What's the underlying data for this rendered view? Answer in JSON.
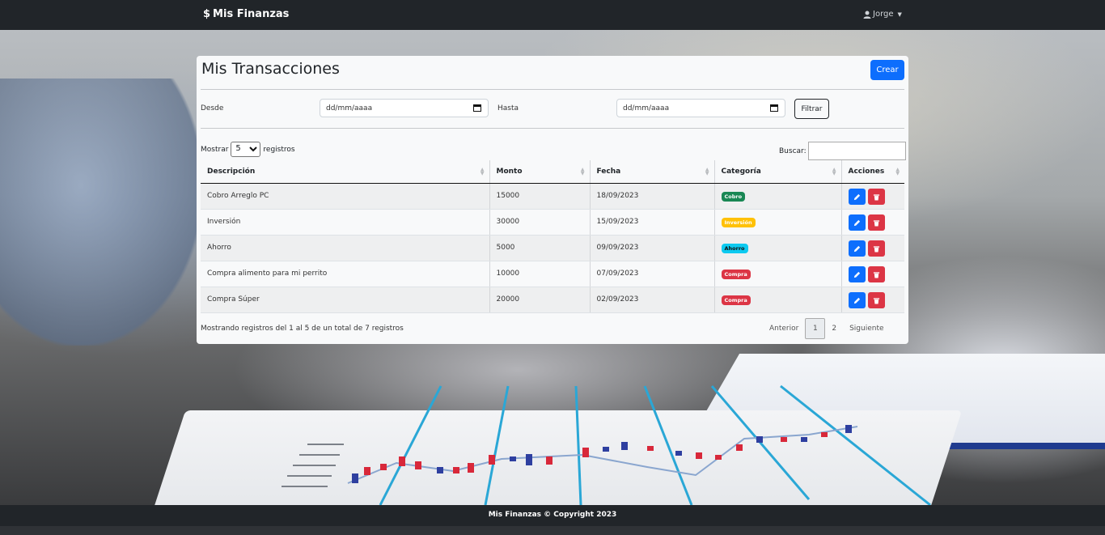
{
  "navbar": {
    "brand": "Mis Finanzas",
    "brand_icon": "dollar-sign-icon",
    "user": "Jorge",
    "user_icon": "person-icon"
  },
  "card": {
    "title": "Mis Transacciones",
    "create_label": "Crear"
  },
  "filter": {
    "from_label": "Desde",
    "from_placeholder": "dd/mm/aaaa",
    "to_label": "Hasta",
    "to_placeholder": "dd/mm/aaaa",
    "button": "Filtrar"
  },
  "table_controls": {
    "show_label": "Mostrar",
    "show_value": "5",
    "records_label": "registros",
    "search_label": "Buscar:"
  },
  "table": {
    "headers": [
      "Descripción",
      "Monto",
      "Fecha",
      "Categoría",
      "Acciones"
    ],
    "rows": [
      {
        "descripcion": "Cobro Arreglo PC",
        "monto": "15000",
        "fecha": "18/09/2023",
        "categoria": "Cobro",
        "color": "#198754"
      },
      {
        "descripcion": "Inversión",
        "monto": "30000",
        "fecha": "15/09/2023",
        "categoria": "Inversión",
        "color": "#ffc107"
      },
      {
        "descripcion": "Ahorro",
        "monto": "5000",
        "fecha": "09/09/2023",
        "categoria": "Ahorro",
        "color": "#0dcaf0"
      },
      {
        "descripcion": "Compra alimento para mi perrito",
        "monto": "10000",
        "fecha": "07/09/2023",
        "categoria": "Compra",
        "color": "#dc3545"
      },
      {
        "descripcion": "Compra Súper",
        "monto": "20000",
        "fecha": "02/09/2023",
        "categoria": "Compra",
        "color": "#dc3545"
      }
    ]
  },
  "info": "Mostrando registros del 1 al 5 de un total de 7 registros",
  "pagination": {
    "prev": "Anterior",
    "pages": [
      "1",
      "2"
    ],
    "current": "1",
    "next": "Siguiente"
  },
  "footer": "Mis Finanzas © Copyright 2023",
  "colors": {
    "navbar": "#212529",
    "primary": "#0d6efd",
    "danger": "#dc3545"
  }
}
